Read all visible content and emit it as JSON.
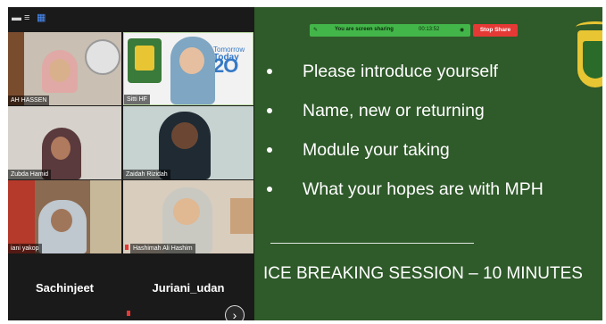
{
  "toolbar": {
    "icons": [
      "minimize-icon",
      "menu-icon",
      "grid-view-icon"
    ]
  },
  "participants": [
    {
      "name": "AH HASSEN"
    },
    {
      "name": "Sitti HF"
    },
    {
      "name": "Zubda Hamid"
    },
    {
      "name": "Zaidah Rizidah"
    },
    {
      "name": "iani yakop"
    },
    {
      "name": "Hashimah Ali Hashim"
    }
  ],
  "name_only_tiles": [
    {
      "name": "Sachinjeet"
    },
    {
      "name": "Juriani_udan"
    }
  ],
  "screen_share": {
    "status": "You are screen sharing",
    "timer": "00:13:52",
    "stop_label": "Stop Share"
  },
  "slide": {
    "bullets": [
      "Please introduce yourself",
      "Name, new or returning",
      "Module your taking",
      "What your hopes are with MPH"
    ],
    "footer": "ICE BREAKING SESSION – 10 MINUTES"
  },
  "banner_text": {
    "tomorrow": "Tomorrow",
    "today": "Today"
  },
  "colors": {
    "slide_bg": "#2f5a2a",
    "share_green": "#43b649",
    "stop_red": "#e53935"
  },
  "next_icon": "chevron-right-icon"
}
